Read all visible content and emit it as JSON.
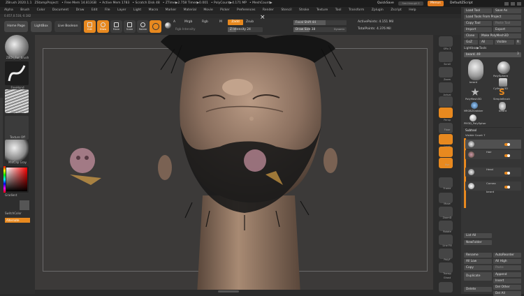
{
  "titlebar": {
    "app": "ZBrush 2020.1.1",
    "project": "ZStampProject:",
    "free_mem": "• Free Mem 14.813GB",
    "active_mem": "• Active Mem 1783",
    "scratch": "• Scratch Disk 48",
    "ztime": "• ZTime▶2.758 Timer▶0.001",
    "polycount": "• PolyCount▶4.171 MP",
    "meshcount": "• MeshCount▶",
    "quicksave": "QuickSave",
    "see_through": "See-through 0",
    "menus": "Menus",
    "default_zscript": "DefaultZScript"
  },
  "menubar": [
    "Alpha",
    "Brush",
    "Color",
    "Document",
    "Draw",
    "Edit",
    "File",
    "Layer",
    "Light",
    "Macro",
    "Marker",
    "Material",
    "Movie",
    "Picker",
    "Preferences",
    "Render",
    "Stencil",
    "Stroke",
    "Texture",
    "Tool",
    "Transform",
    "Zplugin",
    "Zscript",
    "Help"
  ],
  "coords": "0.057,0.516,-0.182",
  "toolbar": {
    "home": "Home Page",
    "lightbox": "LightBox",
    "live_boolean": "Live Boolean",
    "edit": "Edit",
    "draw": "Draw",
    "move": "Move",
    "scale": "Scale",
    "rotate": "Rotate",
    "a": "A",
    "mrgb": "Mrgb",
    "rgb": "Rgb",
    "m": "M",
    "zadd": "Zadd",
    "zsub": "Zsub",
    "rgb_intensity": "Rgb Intensity",
    "z_intensity": "Z Intensity 24",
    "focal_shift": "Focal Shift 44",
    "draw_size": "Draw Size 38",
    "dynamic": "Dynamic",
    "active_points": "ActivePoints: 4.151 Mil",
    "total_points": "TotalPoints: 4.376 Mil"
  },
  "leftshelf": {
    "brush": "ZBDs_Fur_brush",
    "stroke": "FreeHand",
    "alpha": "Alpha Off",
    "texture": "Texture Off",
    "material": "MatCap Gray",
    "gradient": "Gradient",
    "switchcolor": "SwitchColor",
    "alternate": "Alternate"
  },
  "rightshelf": [
    "SPix 3",
    "Scroll",
    "Zoom",
    "Actual",
    "AAHalf",
    "Persp",
    "Floor",
    "Local",
    "LSym",
    "Xyz",
    "Frame",
    "Move",
    "ZoomD",
    "Rotate",
    "Line Fill",
    "PolyF",
    "Transp",
    "Ghost",
    "Solo"
  ],
  "rightpanel": {
    "load_tool": "Load Tool",
    "save_as": "Save As",
    "load_from_project": "Load Tools From Project",
    "copy_tool": "Copy Tool",
    "paste_tool": "Paste Tool",
    "import": "Import",
    "export": "Export",
    "clone": "Clone",
    "make_polymesh": "Make PolyMesh3D",
    "goz": "GoZ",
    "all": "All",
    "visible": "Visible",
    "r": "R",
    "lightbox_tools": "Lightbox▶Tools",
    "tool_name": "beard. 49",
    "tools": [
      "beard",
      "PolySphere",
      "Cylinder3D",
      "PolyMesh3D",
      "SimpleBrush",
      "MRGBZGrabber",
      "beard",
      "PM3D_PolySpher"
    ],
    "tool_count": "3",
    "subtool_header": "Subtool",
    "visible_count": "Visible Count 7",
    "subtools": [
      "Hair",
      "Head",
      "Cornea",
      "beard"
    ],
    "list_all": "List All",
    "new_folder": "NewFolder",
    "rename": "Rename",
    "autoreorder": "AutoReorder",
    "all_low": "All Low",
    "all_high": "All High",
    "copy": "Copy",
    "paste": "Paste",
    "duplicate": "Duplicate",
    "append": "Append",
    "insert": "Insert",
    "delete": "Delete",
    "del_other": "Del Other",
    "del_all": "Del All"
  },
  "colors": {
    "accent": "#e8891f",
    "background": "#2a2a2a",
    "viewport": "#3c3a39"
  }
}
